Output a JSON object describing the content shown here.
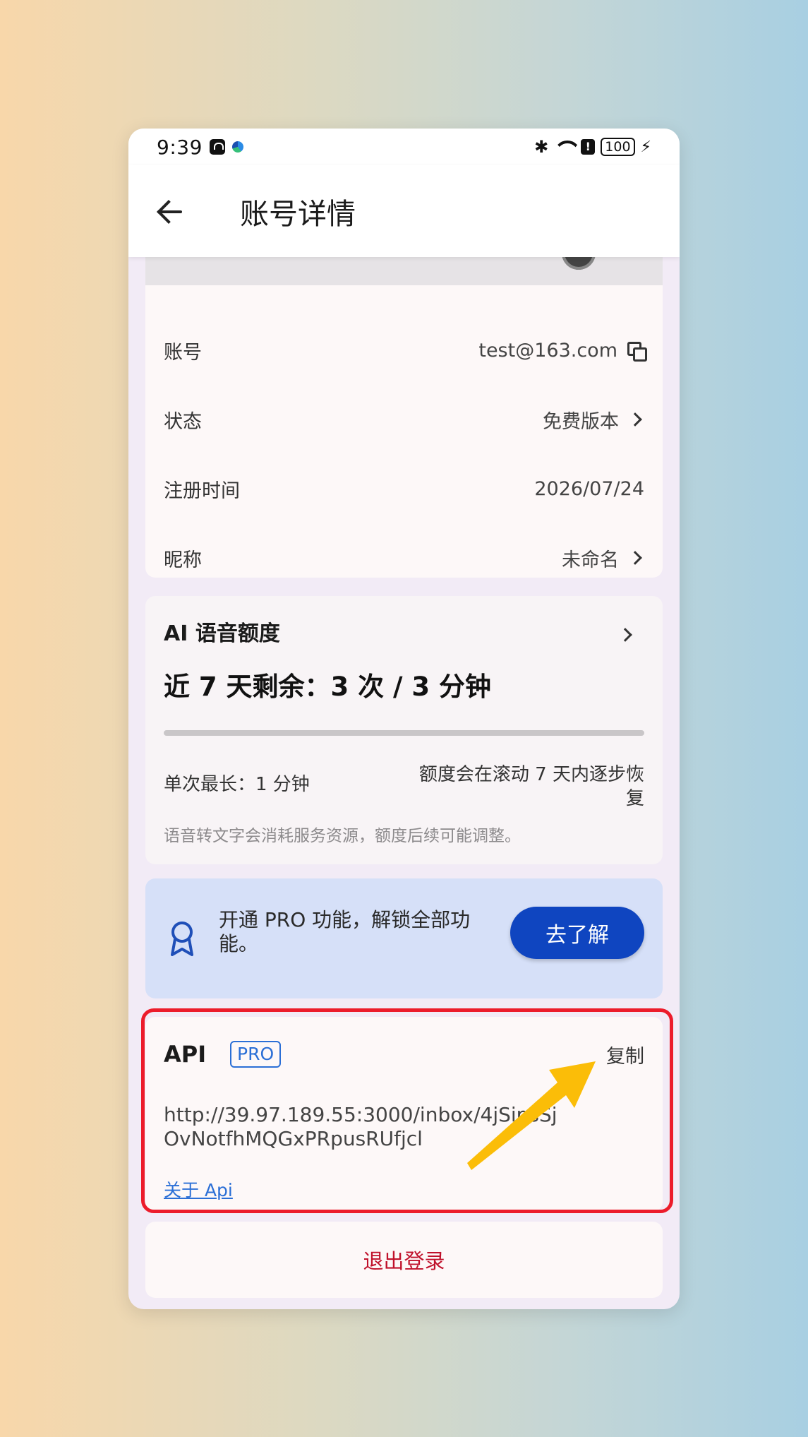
{
  "status_bar": {
    "time": "9:39",
    "bluetooth_icon": "bluetooth-icon",
    "alert": "!",
    "battery": "100"
  },
  "app_bar": {
    "title": "账号详情",
    "back_icon": "arrow-left-icon"
  },
  "account": {
    "rows": [
      {
        "label": "账号",
        "value": "test@163.com",
        "icon": "copy-icon"
      },
      {
        "label": "状态",
        "value": "免费版本",
        "icon": "chevron-right-icon"
      },
      {
        "label": "注册时间",
        "value": "2026/07/24"
      },
      {
        "label": "昵称",
        "value": "未命名",
        "icon": "chevron-right-icon"
      }
    ]
  },
  "quota": {
    "title": "AI 语音额度",
    "remaining": "近 7 天剩余：3 次 / 3 分钟",
    "progress_fraction": 0.0,
    "max_single": "单次最长：1 分钟",
    "recover_note": "额度会在滚动 7 天内逐步恢复",
    "note": "语音转文字会消耗服务资源，额度后续可能调整。"
  },
  "pro": {
    "icon": "award-ribbon-icon",
    "text": "开通 PRO 功能，解锁全部功能。",
    "button": "去了解"
  },
  "api": {
    "title": "API",
    "badge": "PRO",
    "copy": "复制",
    "url": "http://39.97.189.55:3000/inbox/4jSipsSjOvNotfhMQGxPRpusRUfjcl",
    "about": "关于 Api"
  },
  "logout": "退出登录",
  "colors": {
    "accent_blue": "#0f45c0",
    "link_blue": "#2b6fd6",
    "logout_red": "#c0112b",
    "highlight_red": "#ec1c2b",
    "arrow_yellow": "#fbbd08"
  }
}
